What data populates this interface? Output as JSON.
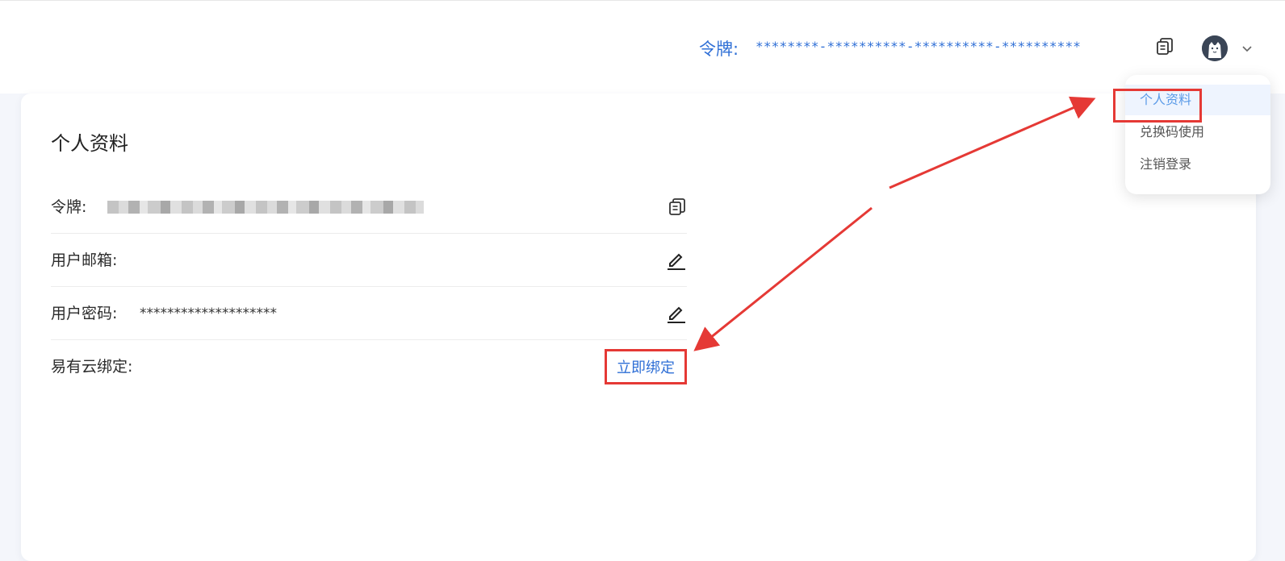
{
  "header": {
    "token_label": "令牌:",
    "token_value": "********-**********-**********-**********"
  },
  "profile": {
    "title": "个人资料",
    "rows": [
      {
        "label": "令牌:",
        "value": ""
      },
      {
        "label": "用户邮箱:",
        "value": ""
      },
      {
        "label": "用户密码:",
        "value": "********************"
      },
      {
        "label": "易有云绑定:",
        "action": "立即绑定"
      }
    ]
  },
  "dropdown": {
    "items": [
      {
        "label": "个人资料"
      },
      {
        "label": "兑换码使用"
      },
      {
        "label": "注销登录"
      }
    ]
  },
  "colors": {
    "accent": "#2f6fd6",
    "annotation": "#e53935"
  },
  "icons": [
    "copy-icon",
    "edit-icon",
    "avatar-icon",
    "chevron-down-icon"
  ]
}
